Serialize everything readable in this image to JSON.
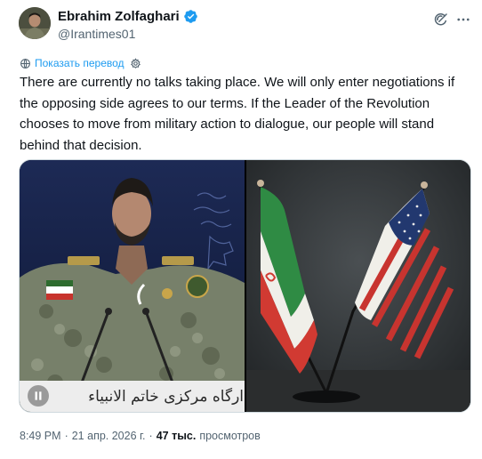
{
  "author": {
    "display_name": "Ebrahim Zolfaghari",
    "handle": "@Irantimes01",
    "verified": true
  },
  "translate": {
    "label": "Показать перевод"
  },
  "tweet": {
    "text": "There are currently no talks taking place. We will only enter negotiations if the opposing side agrees to our terms. If the Leader of the Revolution chooses to move from military action to dialogue, our people will stand behind that decision."
  },
  "media": {
    "left_banner_text": "ارگاه مرکزی خاتم الانبیاء",
    "left_video_state": "playing"
  },
  "meta": {
    "time": "8:49 PM",
    "separator": "·",
    "date": "21 апр. 2026 г.",
    "views_count": "47 тыс.",
    "views_label": "просмотров"
  },
  "colors": {
    "accent": "#1d9bf0",
    "secondary_text": "#536471",
    "primary_text": "#0f1419"
  },
  "icons": [
    "verified-badge-icon",
    "grok-icon",
    "more-icon",
    "globe-icon",
    "settings-icon",
    "pause-icon"
  ]
}
